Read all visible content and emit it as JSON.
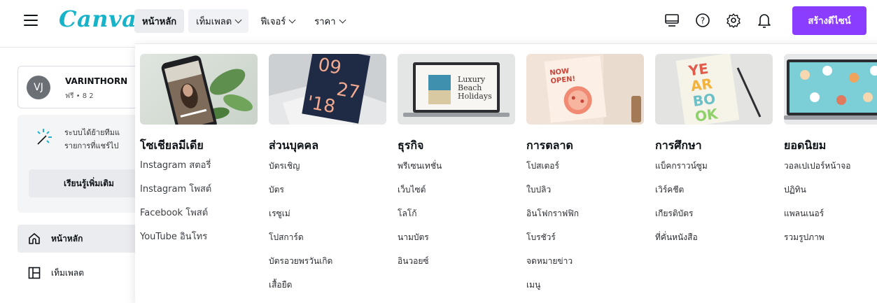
{
  "brand": {
    "logo": "Canva",
    "accent": "#8b3dff",
    "logo_color": "#16b3c9"
  },
  "nav": {
    "items": [
      {
        "label": "หน้าหลัก",
        "has_menu": false
      },
      {
        "label": "เท็มเพลต",
        "has_menu": true
      },
      {
        "label": "ฟีเจอร์",
        "has_menu": true
      },
      {
        "label": "ราคา",
        "has_menu": true
      }
    ]
  },
  "header": {
    "icons": [
      "desktop-icon",
      "help-icon",
      "settings-icon",
      "bell-icon"
    ],
    "create_button": "สร้างดีไซน์"
  },
  "account": {
    "initials": "VJ",
    "name": "VARINTHORN",
    "plan": "ฟรี • 8 2"
  },
  "notice": {
    "line1": "ระบบได้ย้ายทีมแ",
    "line2": "รายการที่แชร์ไป",
    "button": "เรียนรู้เพิ่มเติม"
  },
  "sidebar": {
    "items": [
      {
        "label": "หน้าหลัก",
        "icon": "home-icon"
      },
      {
        "label": "เท็มเพลต",
        "icon": "template-icon"
      }
    ]
  },
  "dropdown": {
    "columns": [
      {
        "title": "โซเชียลมีเดีย",
        "links": [
          "Instagram สตอรี่",
          "Instagram โพสต์",
          "Facebook โพสต์",
          "YouTube อินโทร"
        ]
      },
      {
        "title": "ส่วนบุคคล",
        "thumb_text": {
          "top": "09",
          "big": "27",
          "bottom": "'18"
        },
        "links": [
          "บัตรเชิญ",
          "บัตร",
          "เรซูเม่",
          "โปสการ์ด",
          "บัตรอวยพรวันเกิด",
          "เสื้อยืด"
        ]
      },
      {
        "title": "ธุรกิจ",
        "thumb_text": {
          "l1": "Luxury",
          "l2": "Beach",
          "l3": "Holidays"
        },
        "links": [
          "พรีเซนเทชั่น",
          "เว็บไซต์",
          "โลโก้",
          "นามบัตร",
          "อินวอยซ์"
        ]
      },
      {
        "title": "การตลาด",
        "thumb_text": {
          "l1": "NOW",
          "l2": "OPEN!"
        },
        "links": [
          "โปสเตอร์",
          "ใบปลิว",
          "อินโฟกราฟฟิก",
          "โบรชัวร์",
          "จดหมายข่าว",
          "เมนู"
        ]
      },
      {
        "title": "การศึกษา",
        "thumb_text": {
          "l1": "YE",
          "l2": "AR",
          "l3": "BO",
          "l4": "OK"
        },
        "links": [
          "แบ็คกราวน์ซูม",
          "เวิร์คชีต",
          "เกียรติบัตร",
          "ที่คั่นหนังสือ"
        ]
      },
      {
        "title": "ยอดนิยม",
        "links": [
          "วอลเปเปอร์หน้าจอ",
          "ปฏิทิน",
          "แพลนเนอร์",
          "รวมรูปภาพ"
        ]
      }
    ]
  }
}
